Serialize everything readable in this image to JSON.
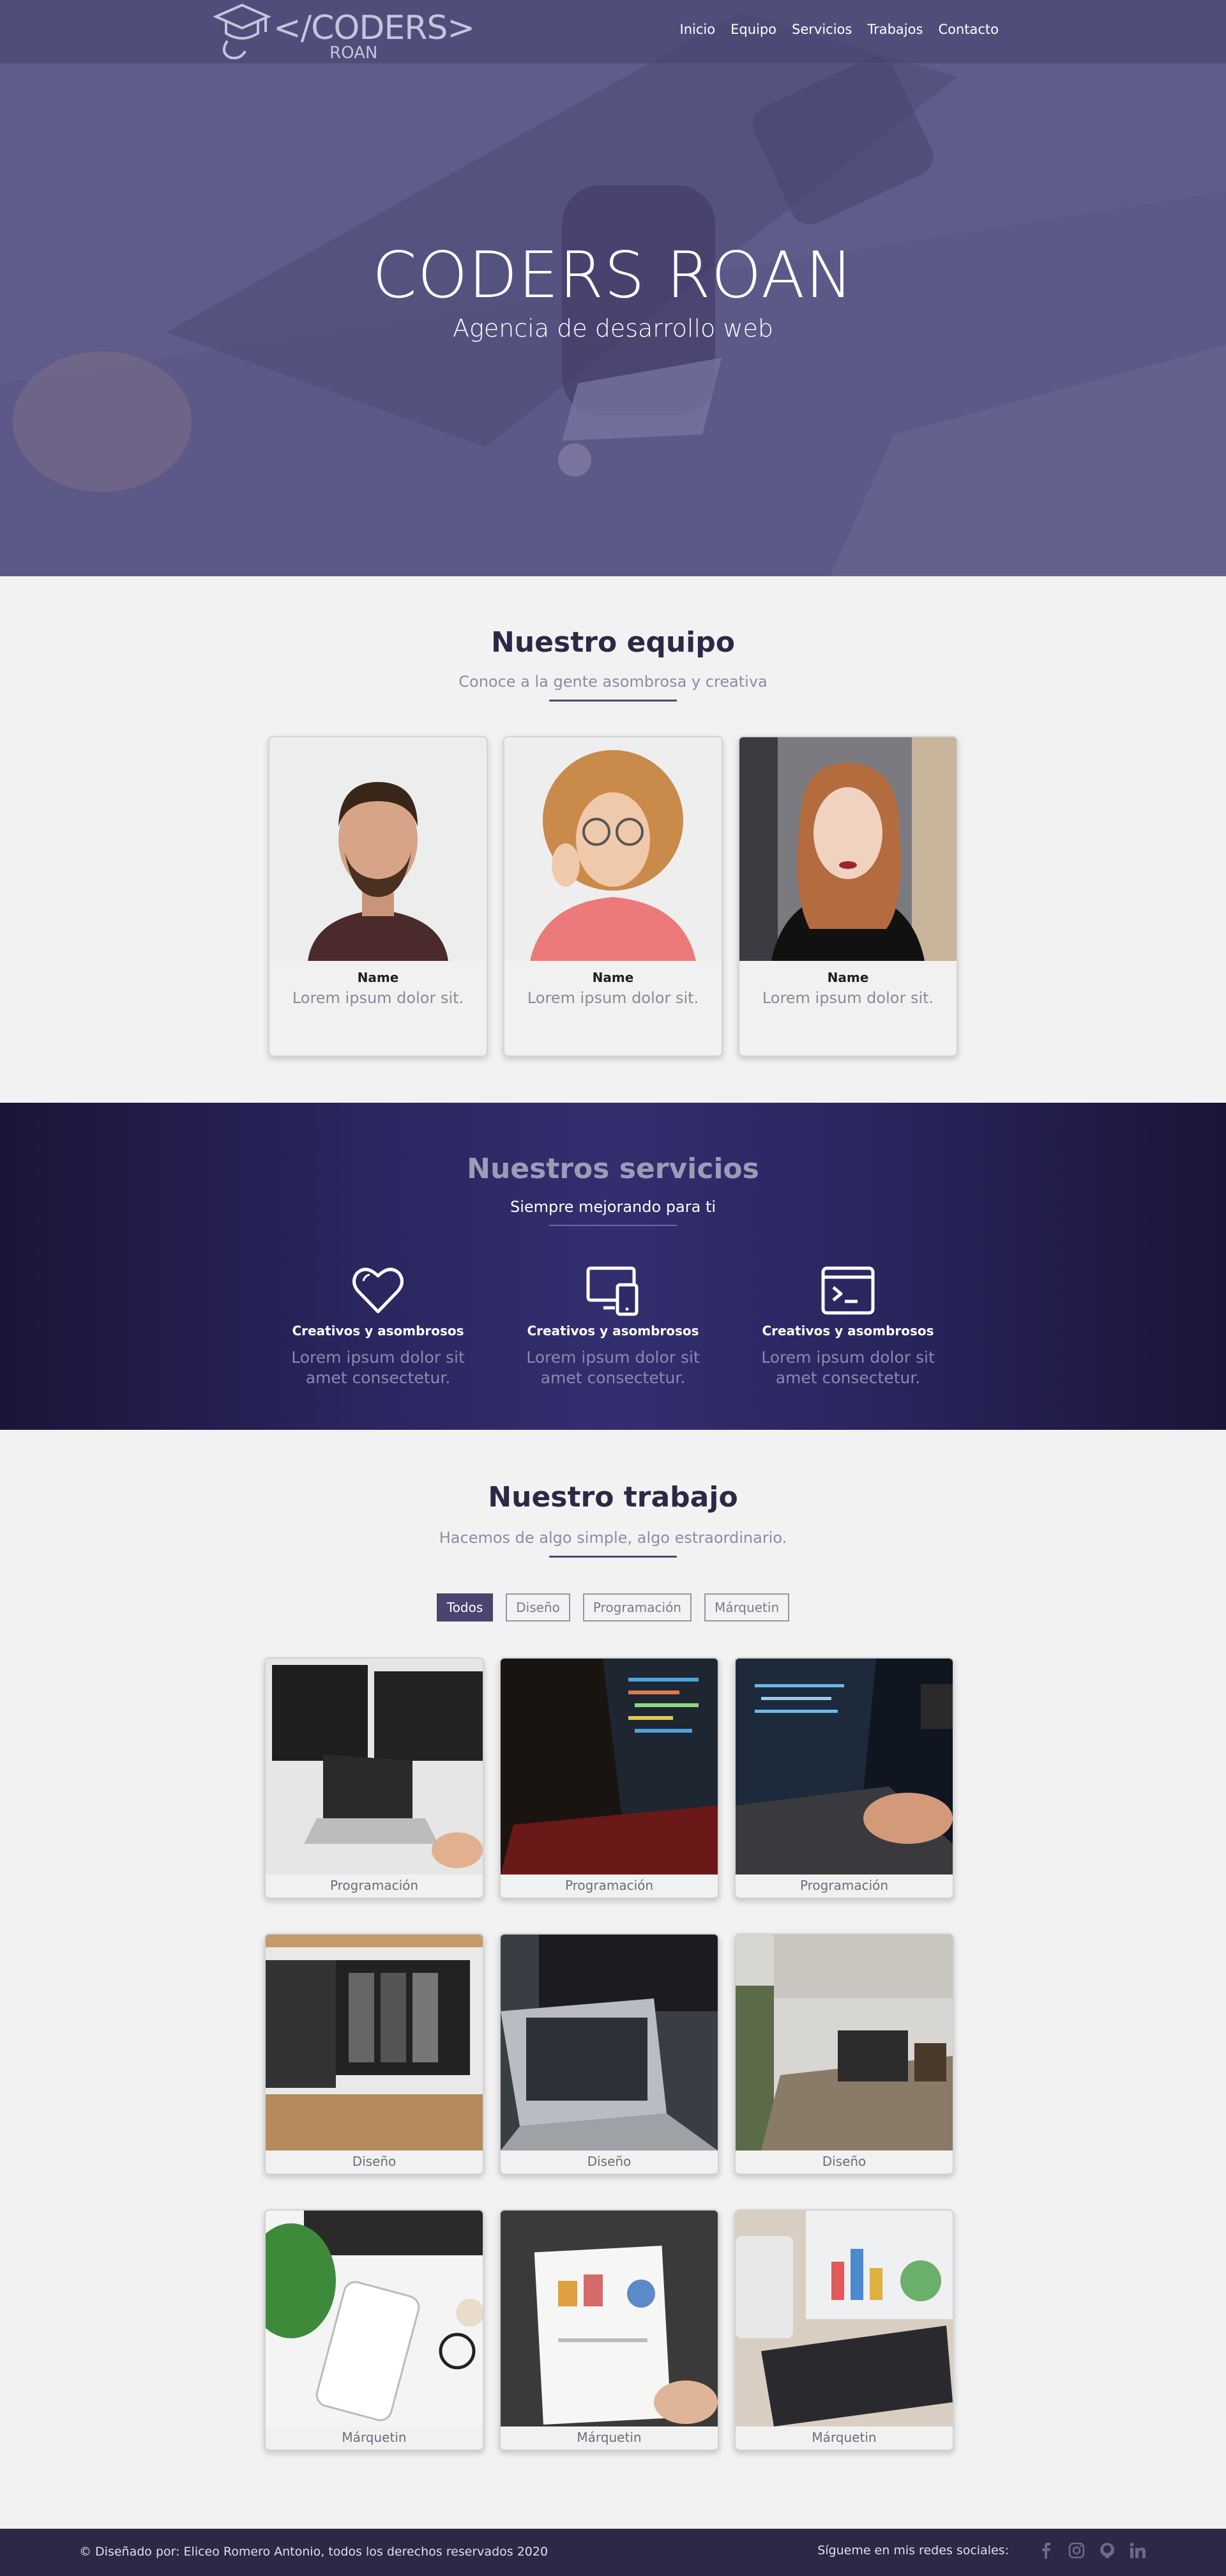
{
  "nav": {
    "logo_text": "</CODERS>",
    "logo_sub": "ROAN",
    "links": [
      "Inicio",
      "Equipo",
      "Servicios",
      "Trabajos",
      "Contacto"
    ]
  },
  "hero": {
    "title": "CODERS ROAN",
    "subtitle": "Agencia de desarrollo web"
  },
  "team": {
    "title": "Nuestro equipo",
    "subtitle": "Conoce a la gente asombrosa y creativa",
    "members": [
      {
        "name": "Name",
        "desc": "Lorem ipsum dolor sit."
      },
      {
        "name": "Name",
        "desc": "Lorem ipsum dolor sit."
      },
      {
        "name": "Name",
        "desc": "Lorem ipsum dolor sit."
      }
    ]
  },
  "services": {
    "title": "Nuestros servicios",
    "subtitle": "Siempre mejorando para ti",
    "items": [
      {
        "icon": "heart-icon",
        "title": "Creativos y asombrosos",
        "desc": "Lorem ipsum dolor sit amet consectetur."
      },
      {
        "icon": "devices-icon",
        "title": "Creativos y asombrosos",
        "desc": "Lorem ipsum dolor sit amet consectetur."
      },
      {
        "icon": "terminal-icon",
        "title": "Creativos y asombrosos",
        "desc": "Lorem ipsum dolor sit amet consectetur."
      }
    ]
  },
  "work": {
    "title": "Nuestro trabajo",
    "subtitle": "Hacemos de algo simple, algo estraordinario.",
    "filters": [
      "Todos",
      "Diseño",
      "Programación",
      "Márquetin"
    ],
    "active_filter": "Todos",
    "items": [
      {
        "label": "Programación"
      },
      {
        "label": "Programación"
      },
      {
        "label": "Programación"
      },
      {
        "label": "Diseño"
      },
      {
        "label": "Diseño"
      },
      {
        "label": "Diseño"
      },
      {
        "label": "Márquetin"
      },
      {
        "label": "Márquetin"
      },
      {
        "label": "Márquetin"
      }
    ]
  },
  "footer": {
    "copyright": "© Diseñado por: Eliceo Romero Antonio, todos los derechos reservados 2020",
    "follow": "Sígueme en mis redes sociales:",
    "social": [
      "facebook-icon",
      "instagram-icon",
      "github-icon",
      "linkedin-icon"
    ]
  },
  "colors": {
    "primary": "#2b2945",
    "accent": "#4a4570",
    "services_bg": "#2b2660"
  }
}
